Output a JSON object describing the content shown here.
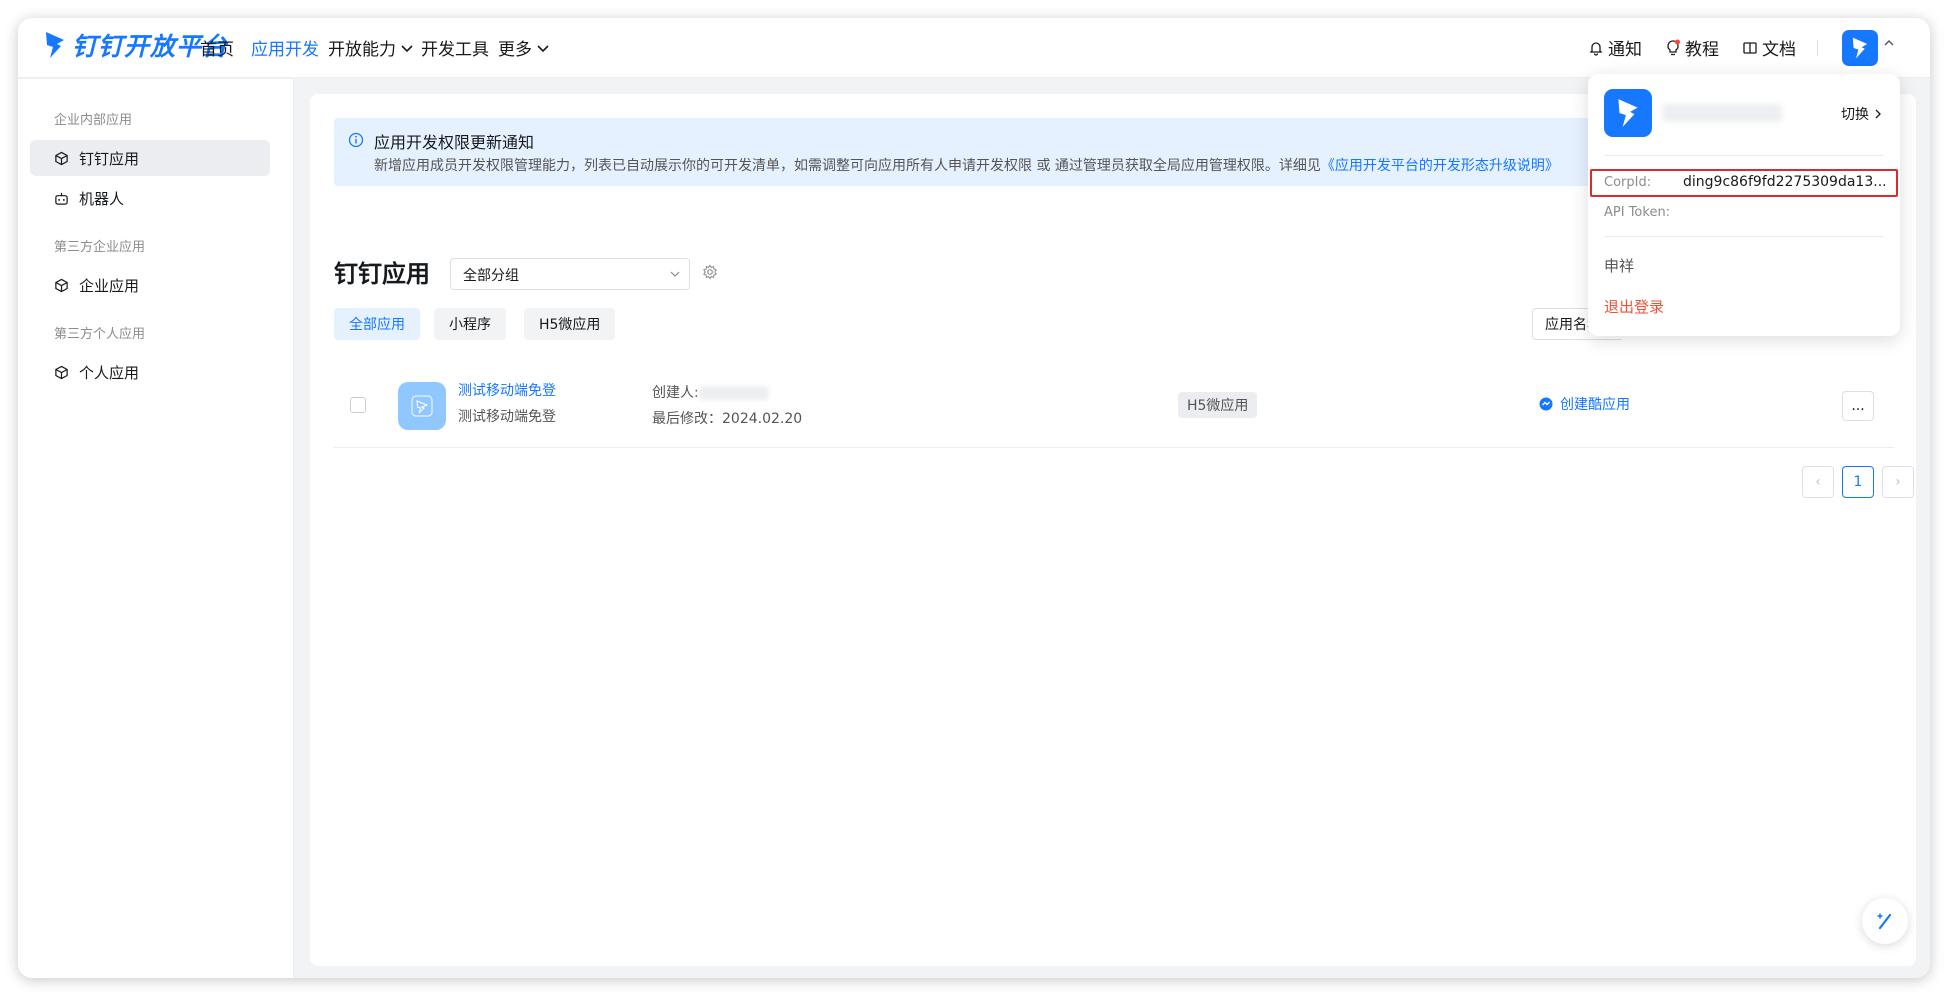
{
  "brand": {
    "name": "钉钉开放平台",
    "color": "#1677ff"
  },
  "nav": {
    "items": [
      {
        "label": "首页",
        "active": false
      },
      {
        "label": "应用开发",
        "active": true
      },
      {
        "label": "开放能力",
        "active": false,
        "dropdown": true
      },
      {
        "label": "开发工具",
        "active": false
      },
      {
        "label": "更多",
        "active": false,
        "dropdown": true
      }
    ],
    "right": [
      {
        "label": "通知",
        "icon": "bell-icon"
      },
      {
        "label": "教程",
        "icon": "bulb-icon"
      },
      {
        "label": "文档",
        "icon": "book-icon"
      }
    ]
  },
  "sidebar": {
    "groups": [
      {
        "title": "企业内部应用",
        "items": [
          {
            "label": "钉钉应用",
            "icon": "cube-icon",
            "active": true
          },
          {
            "label": "机器人",
            "icon": "robot-icon",
            "active": false
          }
        ]
      },
      {
        "title": "第三方企业应用",
        "items": [
          {
            "label": "企业应用",
            "icon": "cube-icon",
            "active": false
          }
        ]
      },
      {
        "title": "第三方个人应用",
        "items": [
          {
            "label": "个人应用",
            "icon": "cube-icon",
            "active": false
          }
        ]
      }
    ]
  },
  "notice": {
    "title": "应用开发权限更新通知",
    "text": "新增应用成员开发权限管理能力，列表已自动展示你的可开发清单，如需调整可向应用所有人申请开发权限 或 通过管理员获取全局应用管理权限。详细见",
    "link": "《应用开发平台的开发形态升级说明》"
  },
  "main": {
    "title": "钉钉应用",
    "group_select": "全部分组",
    "tabs": [
      {
        "label": "全部应用",
        "active": true
      },
      {
        "label": "小程序",
        "active": false
      },
      {
        "label": "H5微应用",
        "active": false
      }
    ],
    "name_filter": "应用名称"
  },
  "apps": [
    {
      "name": "测试移动端免登",
      "desc": "测试移动端免登",
      "creator_label": "创建人:",
      "modified": "最后修改：2024.02.20",
      "type": "H5微应用",
      "action": "创建酷应用",
      "more": "..."
    }
  ],
  "pagination": {
    "prev": "‹",
    "current": "1",
    "next": "›"
  },
  "account_menu": {
    "switch_label": "切换",
    "corpid_label": "CorpId:",
    "corpid_value": "ding9c86f9fd2275309da13...",
    "api_token_label": "API Token:",
    "user_name": "申祥",
    "logout": "退出登录"
  }
}
